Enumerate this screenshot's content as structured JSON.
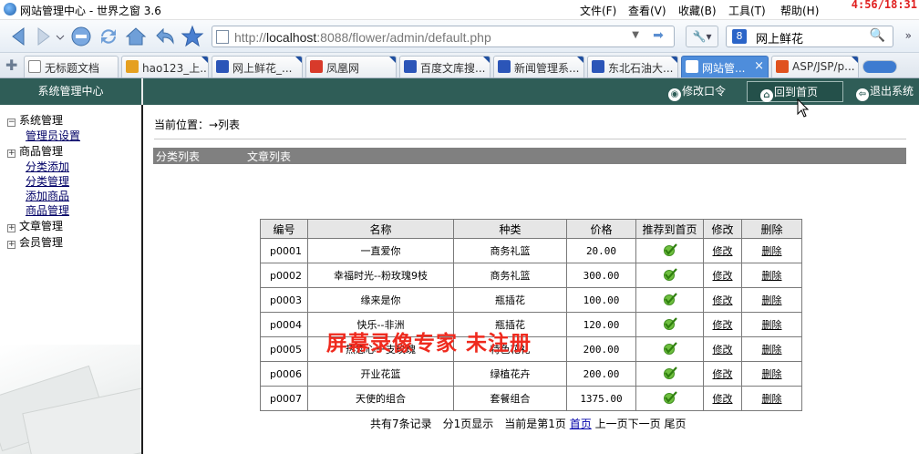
{
  "browser": {
    "window_title": "网站管理中心 - 世界之窗 3.6",
    "menu": [
      "文件(F)",
      "查看(V)",
      "收藏(B)",
      "工具(T)",
      "帮助(H)"
    ],
    "clock": "4:56/18:31",
    "url_prefix": "http://",
    "url_host": "localhost",
    "url_rest": ":8088/flower/admin/default.php",
    "search_value": "网上鲜花",
    "tabs": [
      {
        "label": "无标题文档",
        "active": false
      },
      {
        "label": "hao123_上...",
        "active": false
      },
      {
        "label": "网上鲜花_...",
        "active": false
      },
      {
        "label": "凤凰网",
        "active": false
      },
      {
        "label": "百度文库搜...",
        "active": false
      },
      {
        "label": "新闻管理系...",
        "active": false
      },
      {
        "label": "东北石油大...",
        "active": false
      },
      {
        "label": "网站管...",
        "active": true
      },
      {
        "label": "ASP/JSP/p...",
        "active": false
      }
    ]
  },
  "header": {
    "system_center": "系统管理中心",
    "change_password": "修改口令",
    "back_home": "回到首页",
    "logout": "退出系统"
  },
  "sidebar": {
    "groups": [
      {
        "label": "系统管理",
        "expanded": true,
        "items": [
          "管理员设置"
        ]
      },
      {
        "label": "商品管理",
        "expanded": true,
        "items": [
          "分类添加",
          "分类管理",
          "添加商品",
          "商品管理"
        ]
      },
      {
        "label": "文章管理",
        "expanded": false,
        "items": []
      },
      {
        "label": "会员管理",
        "expanded": false,
        "items": []
      }
    ]
  },
  "main": {
    "breadcrumb": "当前位置：→列表",
    "subtabs": [
      "分类列表",
      "文章列表"
    ],
    "table": {
      "headers": [
        "编号",
        "名称",
        "种类",
        "价格",
        "推荐到首页",
        "修改",
        "删除"
      ],
      "rows": [
        {
          "code": "p0001",
          "name": "一直爱你",
          "category": "商务礼篮",
          "price": "20.00",
          "edit": "修改",
          "delete": "删除"
        },
        {
          "code": "p0002",
          "name": "幸福时光--粉玫瑰9枝",
          "category": "商务礼篮",
          "price": "300.00",
          "edit": "修改",
          "delete": "删除"
        },
        {
          "code": "p0003",
          "name": "缘来是你",
          "category": "瓶插花",
          "price": "100.00",
          "edit": "修改",
          "delete": "删除"
        },
        {
          "code": "p0004",
          "name": "快乐--非洲",
          "category": "瓶插花",
          "price": "120.00",
          "edit": "修改",
          "delete": "删除"
        },
        {
          "code": "p0005",
          "name": "热恋心一支玫瑰",
          "category": "特色花礼",
          "price": "200.00",
          "edit": "修改",
          "delete": "删除"
        },
        {
          "code": "p0006",
          "name": "开业花篮",
          "category": "绿植花卉",
          "price": "200.00",
          "edit": "修改",
          "delete": "删除"
        },
        {
          "code": "p0007",
          "name": "天使的组合",
          "category": "套餐组合",
          "price": "1375.00",
          "edit": "修改",
          "delete": "删除"
        }
      ]
    },
    "pager": {
      "summary": "共有7条记录　分1页显示　当前是第1页",
      "first": "首页",
      "prev": "上一页",
      "next": "下一页",
      "last": "尾页"
    },
    "overlay_text": "屏幕录像专家  未注册"
  },
  "colors": {
    "header_bg": "#2f5d57",
    "subtab_bg": "#808080",
    "active_tab": "#4e8ddb",
    "overlay_red": "#ef2a1e"
  }
}
